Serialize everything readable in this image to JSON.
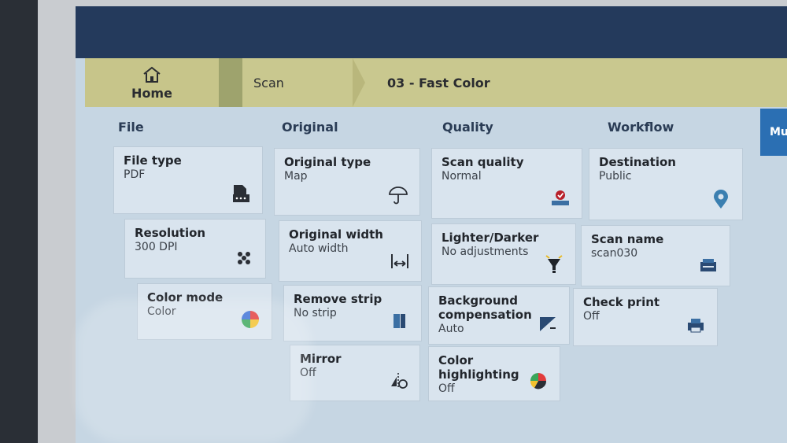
{
  "breadcrumb": {
    "home_label": "Home",
    "scan_label": "Scan",
    "template_label": "03 - Fast Color"
  },
  "side_tab": {
    "label": "Mu"
  },
  "columns": {
    "file": "File",
    "original": "Original",
    "quality": "Quality",
    "workflow": "Workflow"
  },
  "tiles": {
    "file_type": {
      "title": "File type",
      "value": "PDF",
      "icon": "pdf-file-icon"
    },
    "resolution": {
      "title": "Resolution",
      "value": "300 DPI",
      "icon": "dots-icon"
    },
    "color_mode": {
      "title": "Color mode",
      "value": "Color",
      "icon": "color-wheel-icon"
    },
    "original_type": {
      "title": "Original type",
      "value": "Map",
      "icon": "umbrella-icon"
    },
    "original_width": {
      "title": "Original width",
      "value": "Auto width",
      "icon": "width-arrow-icon"
    },
    "remove_strip": {
      "title": "Remove strip",
      "value": "No strip",
      "icon": "strip-icon"
    },
    "mirror": {
      "title": "Mirror",
      "value": "Off",
      "icon": "mirror-icon"
    },
    "scan_quality": {
      "title": "Scan quality",
      "value": "Normal",
      "icon": "quality-icon"
    },
    "lighter_darker": {
      "title": "Lighter/Darker",
      "value": "No adjustments",
      "icon": "bulb-icon"
    },
    "background_comp": {
      "title": "Background compensation",
      "value": "Auto",
      "icon": "background-icon"
    },
    "color_highlight": {
      "title": "Color highlighting",
      "value": "Off",
      "icon": "pie-icon"
    },
    "destination": {
      "title": "Destination",
      "value": "Public",
      "icon": "location-pin-icon"
    },
    "scan_name": {
      "title": "Scan name",
      "value": "scan030",
      "icon": "scanner-icon"
    },
    "check_print": {
      "title": "Check print",
      "value": "Off",
      "icon": "printer-icon"
    }
  },
  "colors": {
    "accent": "#2b6fb3",
    "breadcrumb": "#c9c88f",
    "tile": "#d9e4ee"
  }
}
